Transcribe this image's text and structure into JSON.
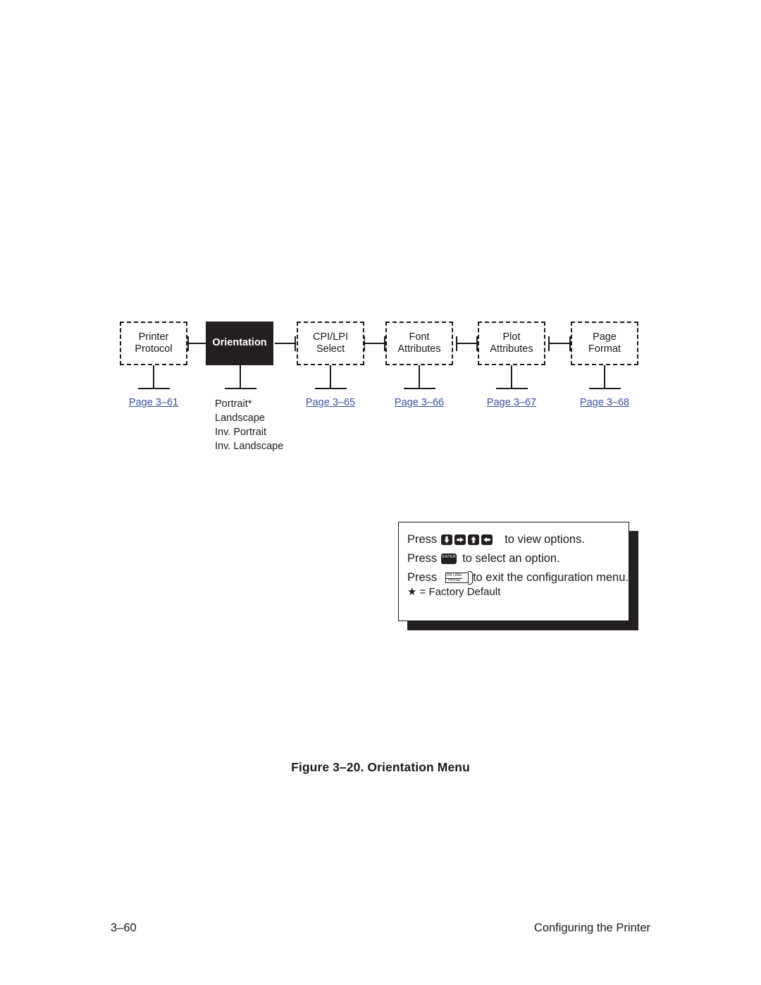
{
  "document": {
    "figure_caption": "Figure 3–20. Orientation Menu",
    "footer_page_number": "3–60",
    "footer_section_title": "Configuring the Printer"
  },
  "diagram": {
    "nodes": [
      {
        "id": "printer-protocol",
        "line1": "Printer",
        "line2": "Protocol",
        "state": "inactive",
        "page_link": "Page 3–61"
      },
      {
        "id": "orientation",
        "line1": "Orientation",
        "line2": "",
        "state": "current",
        "page_link": ""
      },
      {
        "id": "cpi-lpi-select",
        "line1": "CPI/LPI",
        "line2": "Select",
        "state": "inactive",
        "page_link": "Page 3–65"
      },
      {
        "id": "font-attributes",
        "line1": "Font",
        "line2": "Attributes",
        "state": "inactive",
        "page_link": "Page 3–66"
      },
      {
        "id": "plot-attributes",
        "line1": "Plot",
        "line2": "Attributes",
        "state": "inactive",
        "page_link": "Page 3–67"
      },
      {
        "id": "page-format",
        "line1": "Page",
        "line2": "Format",
        "state": "inactive",
        "page_link": "Page 3–68"
      }
    ],
    "orientation_options": [
      "Portrait*",
      "Landscape",
      "Inv. Portrait",
      "Inv. Landscape"
    ]
  },
  "note_box": {
    "line1_lead": "Press",
    "line1_tail": "to view options.",
    "line2_lead": "Press",
    "line2_tail": "to select an option.",
    "line3_lead": "Press",
    "line3_tail": "to exit the configuration menu.",
    "line4": "★ = Factory Default",
    "keys": {
      "arrow_down": "down-arrow-key",
      "arrow_right": "right-arrow-key",
      "arrow_up": "up-arrow-key",
      "arrow_left": "left-arrow-key",
      "enter_label": "ENTER",
      "online_label_line1": "ON LINE/",
      "online_label_line2": "PAUSE"
    }
  },
  "colors": {
    "link": "#3b51a3",
    "ink": "#1a1a1a",
    "current_node_fill": "#231f20",
    "page_background": "#ffffff"
  }
}
